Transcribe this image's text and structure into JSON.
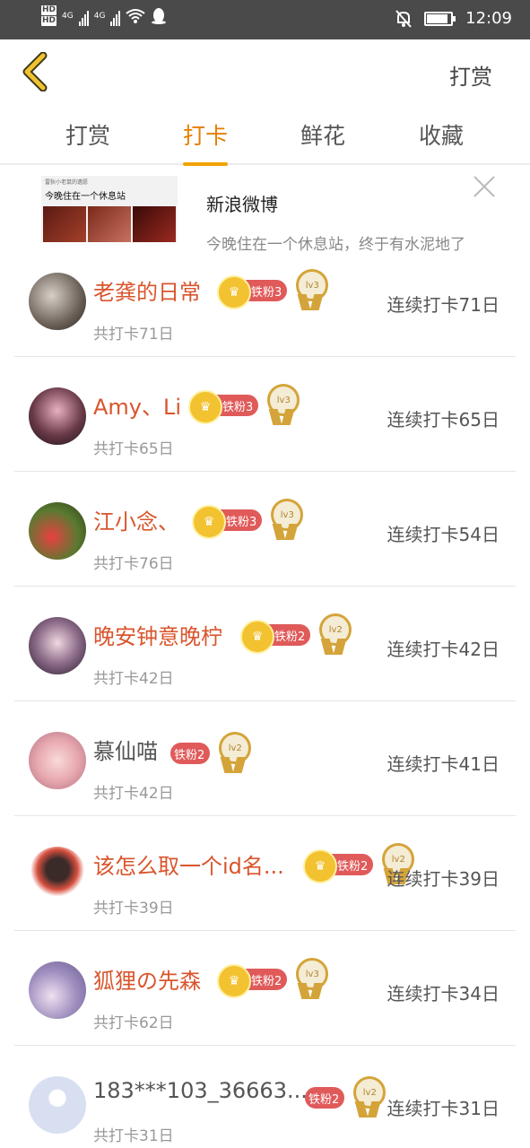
{
  "status": {
    "time": "12:09",
    "net1": "4G",
    "net2": "4G",
    "hd": "HD"
  },
  "topbar": {
    "action_label": "打赏"
  },
  "tabs": [
    {
      "label": "打赏",
      "active": false
    },
    {
      "label": "打卡",
      "active": true
    },
    {
      "label": "鲜花",
      "active": false
    },
    {
      "label": "收藏",
      "active": false
    }
  ],
  "ad": {
    "source": "新浪微博",
    "description": "今晚住在一个休息站，终于有水泥地了",
    "thumb_caption_top": "雷狄小老鼠的遗愿",
    "thumb_caption": "今晚住在一个休息站"
  },
  "rows": [
    {
      "name": "老龚的日常",
      "fan_badge": "铁粉3",
      "crown": true,
      "level": "lv3",
      "total": "共打卡71日",
      "streak": "连续打卡71日",
      "name_color": "red"
    },
    {
      "name": "Amy、Li",
      "fan_badge": "铁粉3",
      "crown": true,
      "level": "lv3",
      "total": "共打卡65日",
      "streak": "连续打卡65日",
      "name_color": "red"
    },
    {
      "name": "江小念、",
      "fan_badge": "铁粉3",
      "crown": true,
      "level": "lv3",
      "total": "共打卡76日",
      "streak": "连续打卡54日",
      "name_color": "red"
    },
    {
      "name": "晚安钟意晚柠",
      "fan_badge": "铁粉2",
      "crown": true,
      "level": "lv2",
      "total": "共打卡42日",
      "streak": "连续打卡42日",
      "name_color": "red"
    },
    {
      "name": "慕仙喵",
      "fan_badge": "铁粉2",
      "crown": false,
      "level": "lv2",
      "total": "共打卡42日",
      "streak": "连续打卡41日",
      "name_color": "gray"
    },
    {
      "name": "该怎么取一个id名...",
      "fan_badge": "铁粉2",
      "crown": true,
      "level": "lv2",
      "total": "共打卡39日",
      "streak": "连续打卡39日",
      "name_color": "red"
    },
    {
      "name": "狐狸の先森",
      "fan_badge": "铁粉2",
      "crown": true,
      "level": "lv3",
      "total": "共打卡62日",
      "streak": "连续打卡34日",
      "name_color": "red"
    },
    {
      "name": "183***103_36663...",
      "fan_badge": "铁粉2",
      "crown": false,
      "level": "lv2",
      "total": "共打卡31日",
      "streak": "连续打卡31日",
      "name_color": "gray"
    }
  ],
  "colors": {
    "accent": "#e67e00",
    "name_red": "#d9552c",
    "badge_red": "#e05a5a",
    "gold": "#d4a43a",
    "statusbar": "#4a4a4a"
  }
}
